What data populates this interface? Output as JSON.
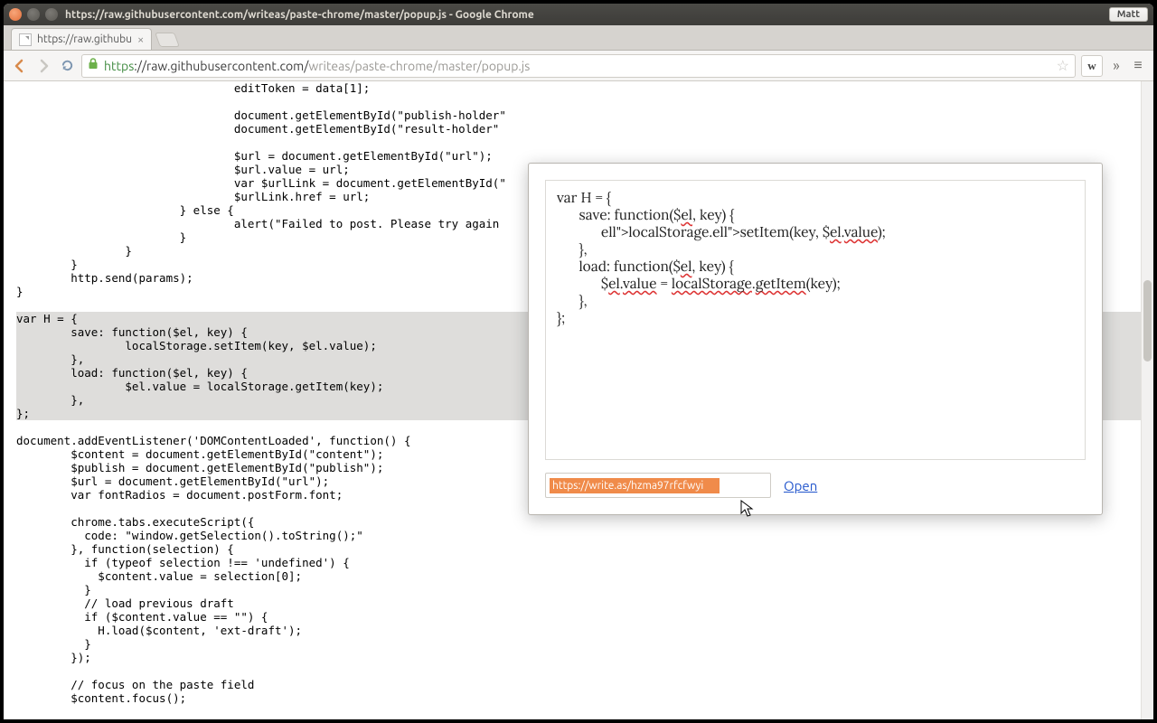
{
  "window": {
    "title": "https://raw.githubusercontent.com/writeas/paste-chrome/master/popup.js - Google Chrome",
    "user_badge": "Matt"
  },
  "tab": {
    "title": "https://raw.githubu"
  },
  "omnibox": {
    "scheme": "https",
    "host": "://raw.githubusercontent.com/",
    "path": "writeas/paste-chrome/master/popup.js"
  },
  "ext_button_label": "w",
  "page_code_top": "                                editToken = data[1];\n\n                                document.getElementById(\"publish-holder\"\n                                document.getElementById(\"result-holder\"\n\n                                $url = document.getElementById(\"url\");\n                                $url.value = url;\n                                var $urlLink = document.getElementById(\"\n                                $urlLink.href = url;\n                        } else {\n                                alert(\"Failed to post. Please try again\n                        }\n                }\n        }\n        http.send(params);\n}\n",
  "page_code_hl": "var H = {\n        save: function($el, key) {\n                localStorage.setItem(key, $el.value);\n        },\n        load: function($el, key) {\n                $el.value = localStorage.getItem(key);\n        },\n};",
  "page_code_bottom": "\ndocument.addEventListener('DOMContentLoaded', function() {\n        $content = document.getElementById(\"content\");\n        $publish = document.getElementById(\"publish\");\n        $url = document.getElementById(\"url\");\n        var fontRadios = document.postForm.font;\n\n        chrome.tabs.executeScript({\n          code: \"window.getSelection().toString();\"\n        }, function(selection) {\n          if (typeof selection !== 'undefined') {\n            $content.value = selection[0];\n          }\n          // load previous draft\n          if ($content.value == \"\") {\n            H.load($content, 'ext-draft');\n          }\n        });\n\n        // focus on the paste field\n        $content.focus();",
  "popup": {
    "editor_lines": [
      {
        "t": "var H = {",
        "s": []
      },
      {
        "t": "      save: function($el, key) {",
        "s": [
          "el"
        ]
      },
      {
        "t": "            localStorage.setItem(key, $el.value);",
        "s": [
          "localStorage",
          "setItem",
          "el",
          "value"
        ]
      },
      {
        "t": "      },",
        "s": []
      },
      {
        "t": "      load: function($el, key) {",
        "s": [
          "el"
        ]
      },
      {
        "t": "            $el.value = localStorage.getItem(key);",
        "s": [
          "el",
          "value",
          "localStorage",
          "getItem"
        ]
      },
      {
        "t": "      },",
        "s": []
      },
      {
        "t": "};",
        "s": []
      }
    ],
    "result_url": "https://write.as/hzma97rfcfwyi",
    "open_label": "Open"
  }
}
